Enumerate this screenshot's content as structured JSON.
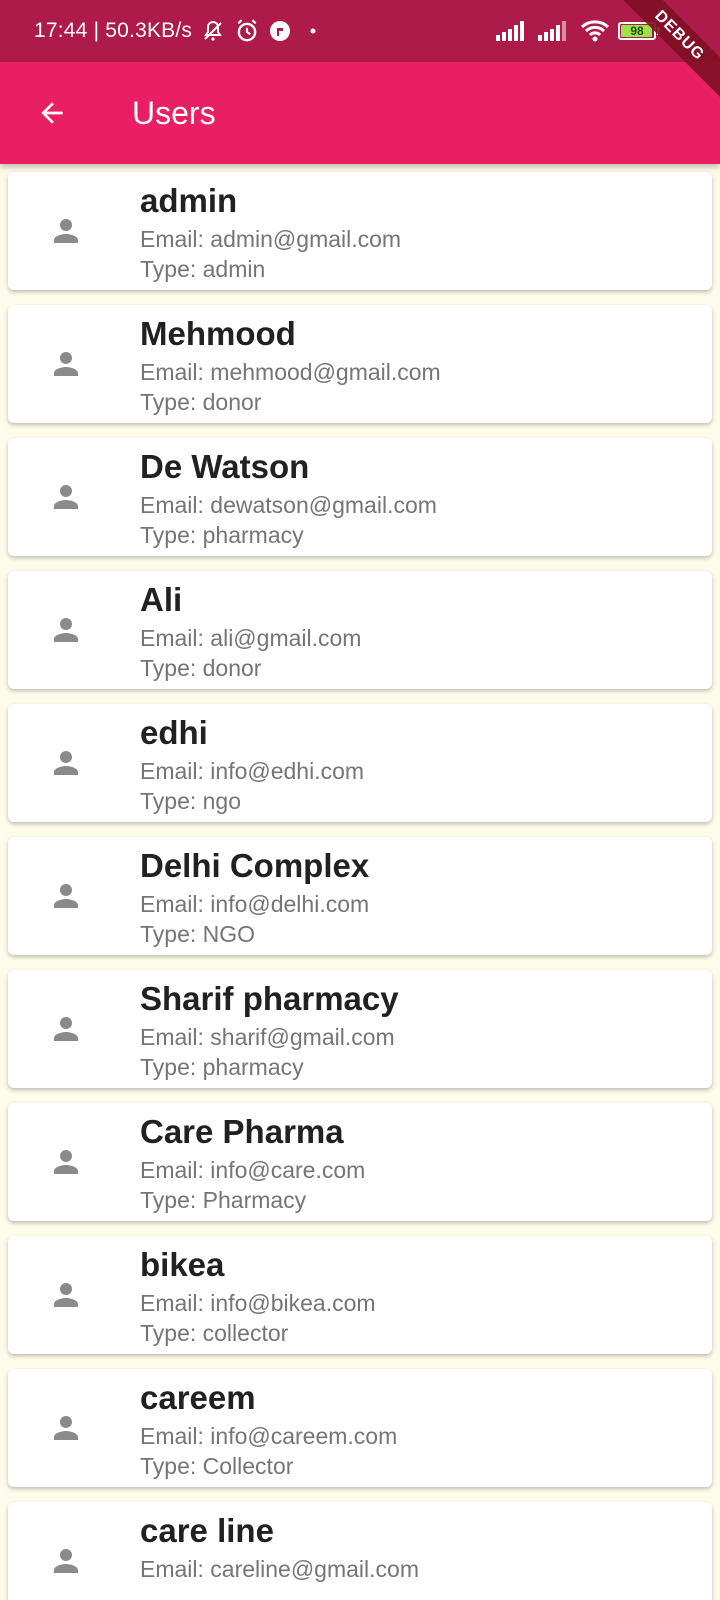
{
  "status_bar": {
    "time": "17:44",
    "network_speed": "50.3KB/s",
    "battery_level": "98",
    "icons": [
      "mute-icon",
      "alarm-icon",
      "app-icon",
      "dot-icon",
      "signal-icon",
      "signal-icon",
      "wifi-icon",
      "battery-icon"
    ]
  },
  "debug_banner": "DEBUG",
  "app_bar": {
    "title": "Users",
    "back_icon": "arrow-back-icon"
  },
  "colors": {
    "status_bar": "#ae1a4a",
    "app_bar": "#e91e63",
    "background": "#fdfbe9",
    "card": "#ffffff",
    "avatar_icon": "#8a8a8a"
  },
  "users": [
    {
      "name": "admin",
      "email": "Email: admin@gmail.com",
      "type": "Type: admin"
    },
    {
      "name": "Mehmood",
      "email": "Email: mehmood@gmail.com",
      "type": "Type: donor"
    },
    {
      "name": "De Watson",
      "email": "Email: dewatson@gmail.com",
      "type": "Type: pharmacy"
    },
    {
      "name": "Ali",
      "email": "Email: ali@gmail.com",
      "type": "Type: donor"
    },
    {
      "name": "edhi",
      "email": "Email: info@edhi.com",
      "type": "Type: ngo"
    },
    {
      "name": "Delhi Complex",
      "email": "Email: info@delhi.com",
      "type": "Type: NGO"
    },
    {
      "name": "Sharif pharmacy",
      "email": "Email: sharif@gmail.com",
      "type": "Type: pharmacy"
    },
    {
      "name": "Care Pharma",
      "email": "Email: info@care.com",
      "type": "Type: Pharmacy"
    },
    {
      "name": "bikea",
      "email": "Email: info@bikea.com",
      "type": "Type: collector"
    },
    {
      "name": "careem",
      "email": "Email: info@careem.com",
      "type": "Type: Collector"
    },
    {
      "name": "care line",
      "email": "Email: careline@gmail.com",
      "type": ""
    }
  ]
}
